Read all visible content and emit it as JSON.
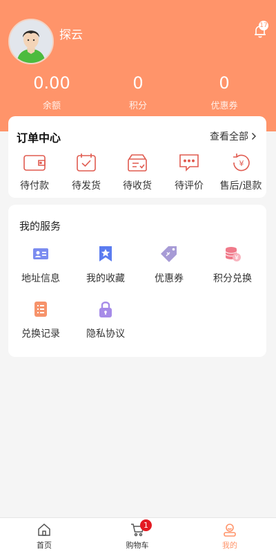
{
  "profile": {
    "username": "探云",
    "notification_count": "17"
  },
  "stats": [
    {
      "value": "0.00",
      "label": "余额"
    },
    {
      "value": "0",
      "label": "积分"
    },
    {
      "value": "0",
      "label": "优惠券"
    }
  ],
  "orders": {
    "title": "订单中心",
    "view_all": "查看全部",
    "items": [
      {
        "label": "待付款",
        "icon": "wallet-icon"
      },
      {
        "label": "待发货",
        "icon": "calendar-check-icon"
      },
      {
        "label": "待收货",
        "icon": "box-icon"
      },
      {
        "label": "待评价",
        "icon": "comment-icon"
      },
      {
        "label": "售后/退款",
        "icon": "refund-icon"
      }
    ]
  },
  "services": {
    "title": "我的服务",
    "items": [
      {
        "label": "地址信息",
        "icon": "id-card-icon"
      },
      {
        "label": "我的收藏",
        "icon": "bookmark-star-icon"
      },
      {
        "label": "优惠券",
        "icon": "coupon-tag-icon"
      },
      {
        "label": "积分兑换",
        "icon": "coins-icon"
      },
      {
        "label": "兑换记录",
        "icon": "list-doc-icon"
      },
      {
        "label": "隐私协议",
        "icon": "lock-icon"
      }
    ]
  },
  "tabbar": {
    "items": [
      {
        "label": "首页",
        "icon": "home-icon"
      },
      {
        "label": "购物车",
        "icon": "cart-icon"
      },
      {
        "label": "我的",
        "icon": "user-icon"
      }
    ],
    "cart_badge": "1",
    "active": "我的"
  },
  "colors": {
    "accent": "#FF946A",
    "order_icon": "#E05A4F",
    "badge": "#E31B23"
  }
}
